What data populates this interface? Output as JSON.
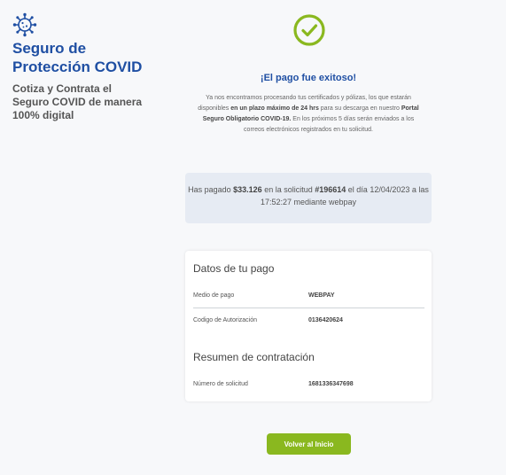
{
  "colors": {
    "brand_blue": "#1f4fa3",
    "success_green": "#8ab81f",
    "panel_bg": "#e6ebf3",
    "page_bg": "#f7f8fa"
  },
  "brand": {
    "icon": "virus-icon",
    "title": "Seguro de\nProtección COVID",
    "subtitle": "Cotiza y Contrata el\nSeguro COVID de manera\n100% digital"
  },
  "status": {
    "icon": "check-circle-icon",
    "headline": "¡El pago fue exitoso!",
    "intro_1": "Ya nos encontramos procesando tus certificados y pólizas, los que estarán disponibles ",
    "intro_bold_1": "en un plazo máximo de 24 hrs",
    "intro_2": " para su descarga en nuestro ",
    "intro_bold_2": "Portal Seguro Obligatorio COVID-19.",
    "intro_3": " En los próximos 5 días serán enviados a los correos electrónicos registrados en tu solicitud."
  },
  "payment_summary": {
    "prefix": "Has pagado ",
    "amount": "$33.126",
    "mid": " en la solicitud ",
    "request_id": "#196614",
    "suffix": " el día 12/04/2023 a las 17:52:27 mediante webpay"
  },
  "details": {
    "payment_title": "Datos de tu pago",
    "payment_rows": [
      {
        "label": "Medio de pago",
        "value": "WEBPAY"
      },
      {
        "label": "Codigo de Autorización",
        "value": "0136420624"
      }
    ],
    "contract_title": "Resumen de contratación",
    "contract_rows": [
      {
        "label": "Número de solicitud",
        "value": "1681336347698"
      }
    ]
  },
  "actions": {
    "back_label": "Volver al Inicio"
  }
}
